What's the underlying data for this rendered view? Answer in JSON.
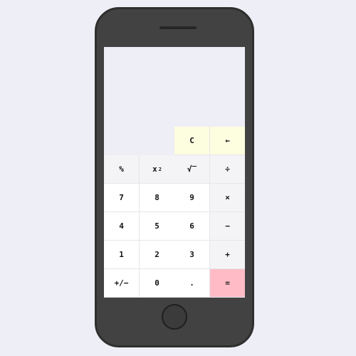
{
  "display": {
    "value": ""
  },
  "keys": {
    "clear": "C",
    "backspace": "←",
    "percent": "%",
    "square": "x",
    "square_exp": "2",
    "sqrt": "√‾",
    "divide": "÷",
    "seven": "7",
    "eight": "8",
    "nine": "9",
    "multiply": "×",
    "four": "4",
    "five": "5",
    "six": "6",
    "minus": "−",
    "one": "1",
    "two": "2",
    "three": "3",
    "plus": "+",
    "negate": "+/−",
    "zero": "0",
    "decimal": ".",
    "equals": "="
  },
  "colors": {
    "page_background": "#eeeef7",
    "phone_body": "#424242",
    "top_key_background": "#fdfde0",
    "equals_background": "#ffbcc6",
    "key_background": "#ffffff",
    "operator_background": "#f4f4f6"
  }
}
